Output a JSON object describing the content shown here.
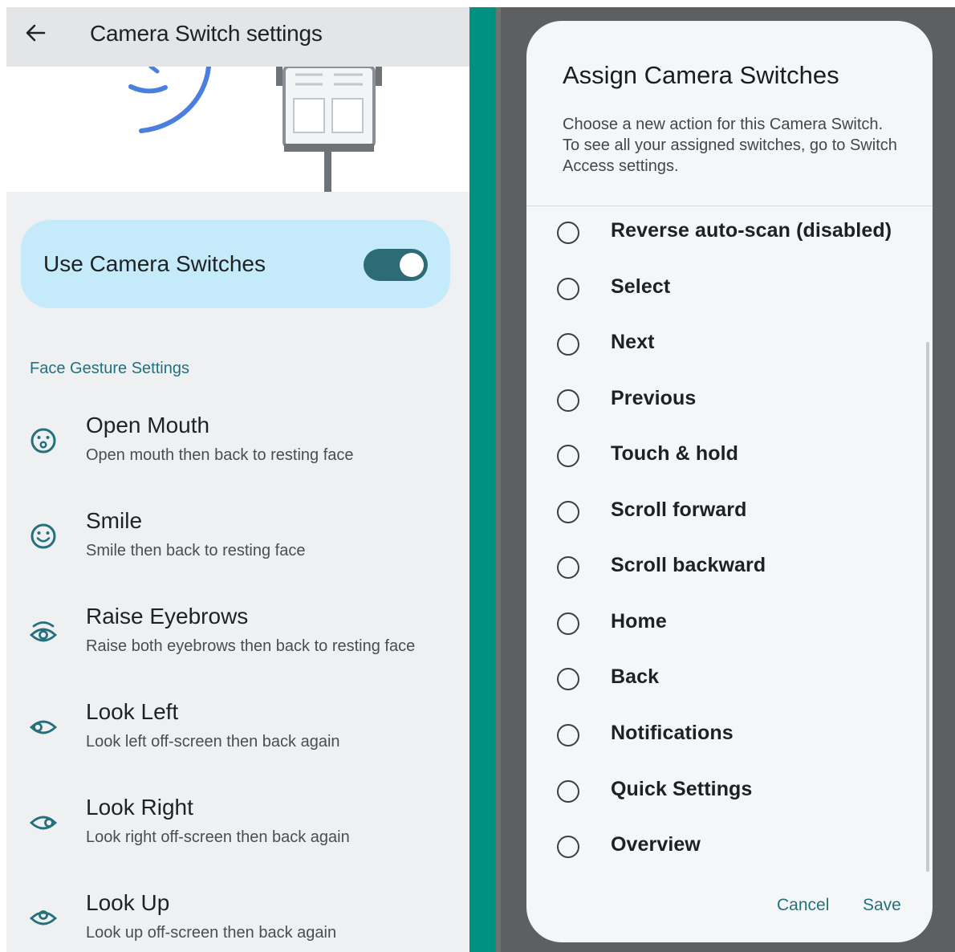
{
  "header": {
    "title": "Camera Switch settings"
  },
  "toggle": {
    "label": "Use Camera Switches",
    "state": "on"
  },
  "section": {
    "title": "Face Gesture Settings"
  },
  "gestures": [
    {
      "title": "Open Mouth",
      "subtitle": "Open mouth then back to resting face",
      "icon": "open-mouth-face-icon"
    },
    {
      "title": "Smile",
      "subtitle": "Smile then back to resting face",
      "icon": "smile-face-icon"
    },
    {
      "title": "Raise Eyebrows",
      "subtitle": "Raise both eyebrows then back to resting face",
      "icon": "raised-eyebrow-eye-icon"
    },
    {
      "title": "Look Left",
      "subtitle": "Look left off-screen then back again",
      "icon": "eye-look-left-icon"
    },
    {
      "title": "Look Right",
      "subtitle": "Look right off-screen then back again",
      "icon": "eye-look-right-icon"
    },
    {
      "title": "Look Up",
      "subtitle": "Look up off-screen then back again",
      "icon": "eye-look-up-icon"
    }
  ],
  "dialog": {
    "title": "Assign Camera Switches",
    "description": "Choose a new action for this Camera Switch. To see all your assigned switches, go to Switch Access settings.",
    "options": [
      "Reverse auto-scan (disabled)",
      "Select",
      "Next",
      "Previous",
      "Touch & hold",
      "Scroll forward",
      "Scroll backward",
      "Home",
      "Back",
      "Notifications",
      "Quick Settings",
      "Overview"
    ],
    "cancel_label": "Cancel",
    "save_label": "Save"
  },
  "colors": {
    "accent": "#24707c",
    "toggle_card": "#c5eaf9",
    "switch_track": "#2d6b77",
    "divider_stripe": "#009183",
    "scrim": "#5e5f60"
  }
}
